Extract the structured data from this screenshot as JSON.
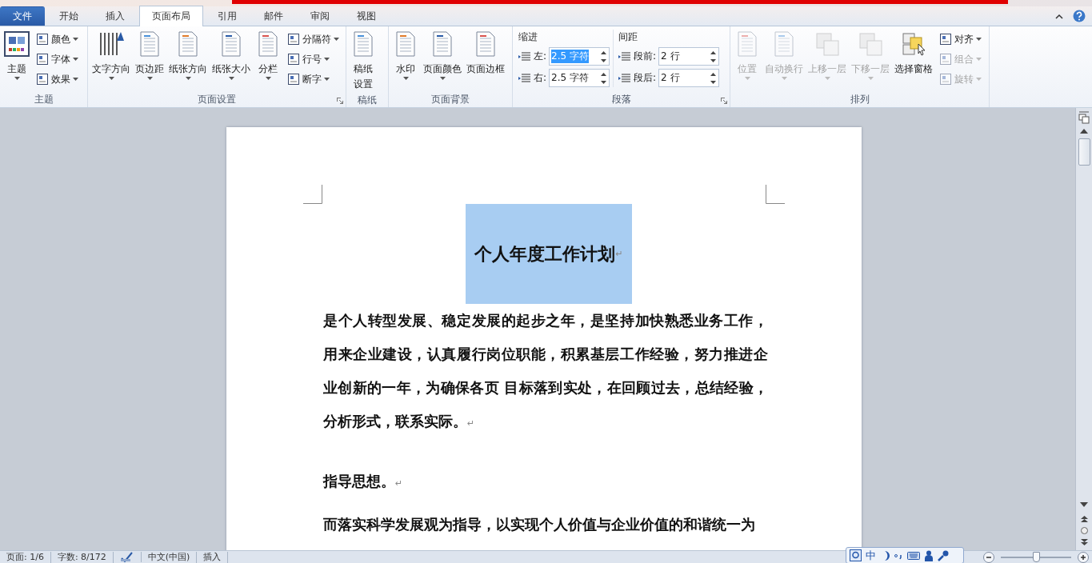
{
  "tabs": [
    {
      "label": "文件",
      "kind": "file",
      "selected": false
    },
    {
      "label": "开始",
      "kind": "tab",
      "selected": false
    },
    {
      "label": "插入",
      "kind": "tab",
      "selected": false
    },
    {
      "label": "页面布局",
      "kind": "tab",
      "selected": true
    },
    {
      "label": "引用",
      "kind": "tab",
      "selected": false
    },
    {
      "label": "邮件",
      "kind": "tab",
      "selected": false
    },
    {
      "label": "审阅",
      "kind": "tab",
      "selected": false
    },
    {
      "label": "视图",
      "kind": "tab",
      "selected": false
    }
  ],
  "ribbon": {
    "groups": [
      {
        "label": "主题",
        "launcher": false,
        "items": [
          {
            "kind": "big",
            "label": "主题",
            "caret": true,
            "disabled": false
          },
          {
            "kind": "smalls",
            "items": [
              {
                "label": "颜色",
                "caret": true,
                "disabled": false
              },
              {
                "label": "字体",
                "caret": true,
                "disabled": false
              },
              {
                "label": "效果",
                "caret": true,
                "disabled": false
              }
            ]
          }
        ]
      },
      {
        "label": "页面设置",
        "launcher": true,
        "items": [
          {
            "kind": "big",
            "label": "文字方向",
            "caret": true,
            "disabled": false
          },
          {
            "kind": "big",
            "label": "页边距",
            "caret": true,
            "disabled": false
          },
          {
            "kind": "big",
            "label": "纸张方向",
            "caret": true,
            "disabled": false
          },
          {
            "kind": "big",
            "label": "纸张大小",
            "caret": true,
            "disabled": false
          },
          {
            "kind": "big",
            "label": "分栏",
            "caret": true,
            "disabled": false
          },
          {
            "kind": "smalls",
            "items": [
              {
                "label": "分隔符",
                "caret": true,
                "disabled": false
              },
              {
                "label": "行号",
                "caret": true,
                "disabled": false
              },
              {
                "label": "断字",
                "caret": true,
                "disabled": false
              }
            ]
          }
        ]
      },
      {
        "label": "稿纸",
        "launcher": false,
        "items": [
          {
            "kind": "tall",
            "label": "稿纸设置",
            "caret": false,
            "disabled": false
          }
        ]
      },
      {
        "label": "页面背景",
        "launcher": false,
        "items": [
          {
            "kind": "big",
            "label": "水印",
            "caret": true,
            "disabled": false
          },
          {
            "kind": "big",
            "label": "页面颜色",
            "caret": true,
            "disabled": false
          },
          {
            "kind": "big",
            "label": "页面边框",
            "caret": false,
            "disabled": false
          }
        ]
      },
      {
        "label": "段落",
        "launcher": true,
        "items": [
          {
            "kind": "spinners",
            "heading": "缩进",
            "rows": [
              {
                "label": "左:",
                "value": "2.5 字符",
                "selected": true
              },
              {
                "label": "右:",
                "value": "2.5 字符",
                "selected": false
              }
            ]
          },
          {
            "kind": "spinners",
            "heading": "间距",
            "rows": [
              {
                "label": "段前:",
                "value": "2 行",
                "selected": false
              },
              {
                "label": "段后:",
                "value": "2 行",
                "selected": false
              }
            ]
          }
        ]
      },
      {
        "label": "排列",
        "launcher": false,
        "items": [
          {
            "kind": "big",
            "label": "位置",
            "caret": true,
            "disabled": true
          },
          {
            "kind": "big",
            "label": "自动换行",
            "caret": true,
            "disabled": true
          },
          {
            "kind": "big",
            "label": "上移一层",
            "caret": true,
            "disabled": true
          },
          {
            "kind": "big",
            "label": "下移一层",
            "caret": true,
            "disabled": true
          },
          {
            "kind": "big",
            "label": "选择窗格",
            "caret": false,
            "disabled": false
          },
          {
            "kind": "smalls",
            "items": [
              {
                "label": "对齐",
                "caret": true,
                "disabled": false
              },
              {
                "label": "组合",
                "caret": true,
                "disabled": true
              },
              {
                "label": "旋转",
                "caret": true,
                "disabled": true
              }
            ]
          }
        ]
      }
    ]
  },
  "document": {
    "title": {
      "text": "个人年度工作计划",
      "selected": true,
      "mark": "↵"
    },
    "paragraphs": [
      {
        "kind": "body",
        "lines": [
          "是个人转型发展、稳定发展的起步之年，是坚持加快熟悉业务工作，",
          "用来企业建设，认真履行岗位职能，积累基层工作经验，努力推进企",
          "业创新的一年，为确保各页 目标落到实处，在回顾过去，总结经验，",
          "分析形式，联系实际。"
        ],
        "mark": "↵"
      },
      {
        "kind": "heading",
        "lines": [
          "指导思想。"
        ],
        "mark": "↵"
      },
      {
        "kind": "body",
        "lines": [
          "而落实科学发展观为指导，以实现个人价值与企业价值的和谐统一为"
        ]
      }
    ]
  },
  "status_bar": {
    "page": "页面: 1/6",
    "words": "字数: 8/172",
    "language": "中文(中国)",
    "mode": "插入",
    "ime": {
      "label": "中"
    },
    "zoom": {
      "level": 0.5
    }
  }
}
